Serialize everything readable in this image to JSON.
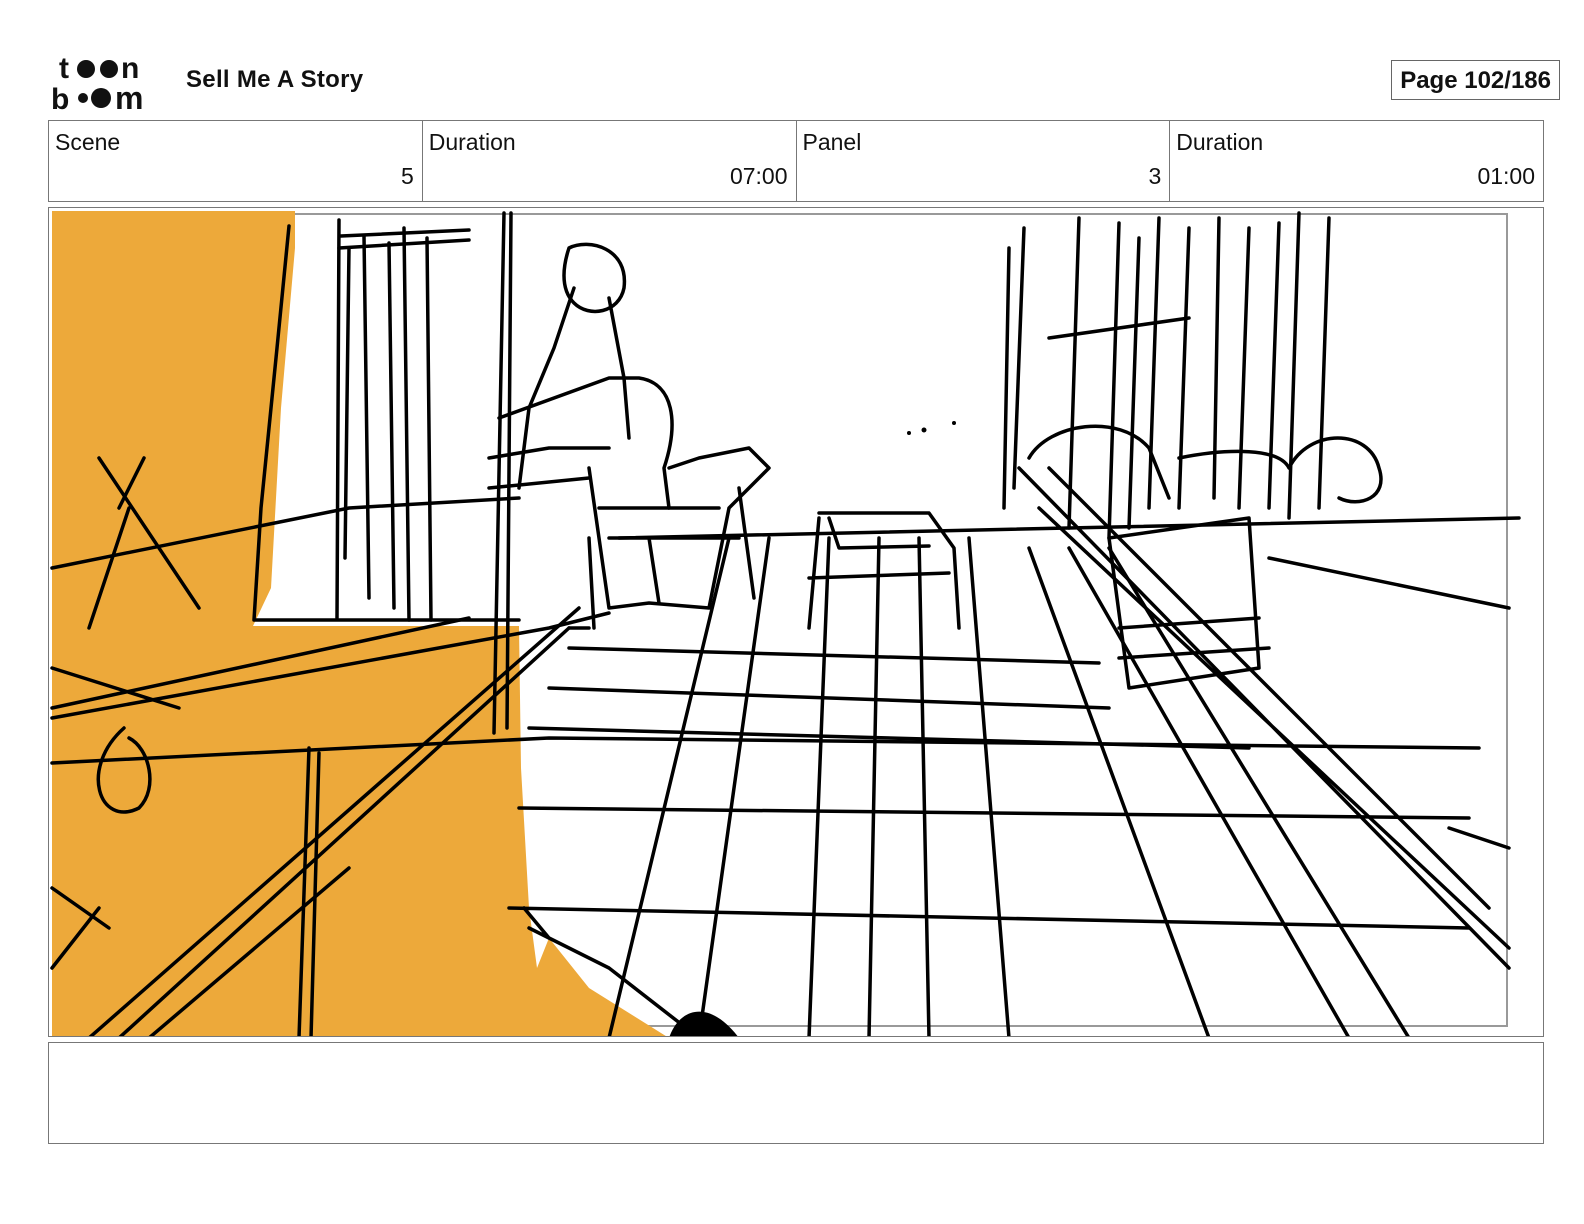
{
  "header": {
    "logo_top": "toon",
    "logo_bottom": "boom",
    "project_title": "Sell Me A Story",
    "page_label": "Page 102/186"
  },
  "info": {
    "scene_label": "Scene",
    "scene_value": "5",
    "scene_duration_label": "Duration",
    "scene_duration_value": "07:00",
    "panel_label": "Panel",
    "panel_value": "3",
    "panel_duration_label": "Duration",
    "panel_duration_value": "01:00"
  },
  "panel": {
    "fill_color": "#EDA93A",
    "line_color": "#000000"
  },
  "notes": {
    "text": ""
  }
}
